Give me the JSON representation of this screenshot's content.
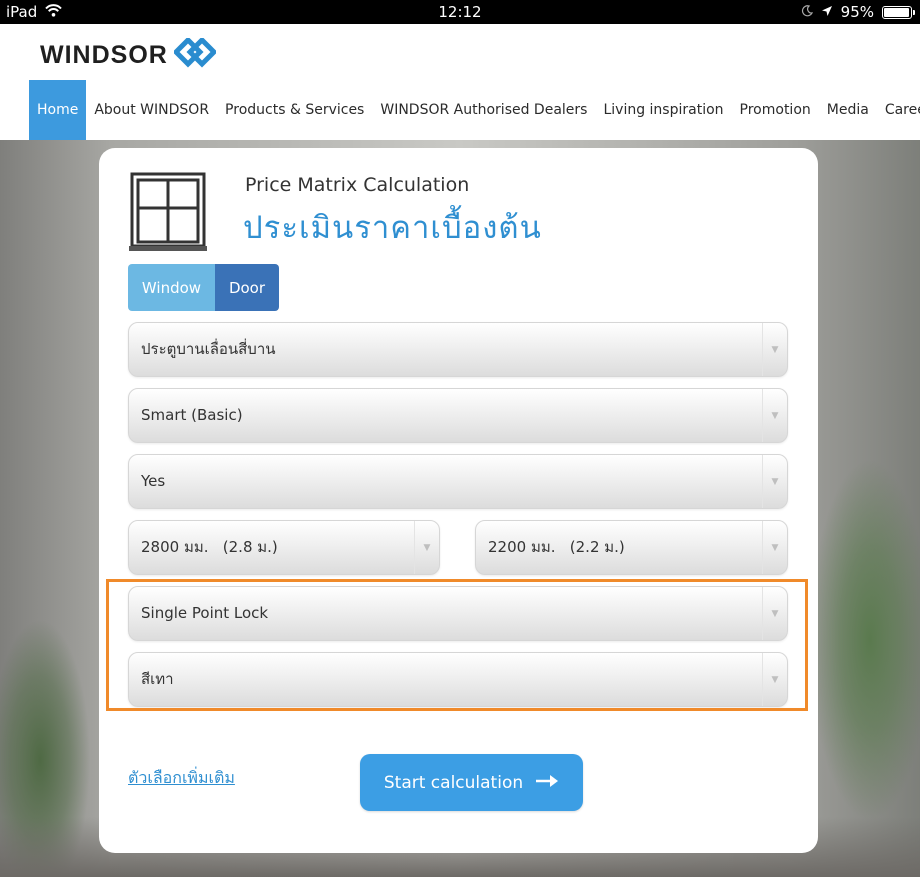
{
  "status_bar": {
    "device": "iPad",
    "time": "12:12",
    "battery": "95%",
    "battery_level": 0.95
  },
  "brand": {
    "name": "WINDSOR",
    "accent": "#3d9ade"
  },
  "nav": {
    "items": [
      {
        "label": "Home",
        "active": true
      },
      {
        "label": "About WINDSOR"
      },
      {
        "label": "Products & Services"
      },
      {
        "label": "WINDSOR Authorised Dealers"
      },
      {
        "label": "Living inspiration"
      },
      {
        "label": "Promotion"
      },
      {
        "label": "Media"
      },
      {
        "label": "Careers"
      }
    ]
  },
  "calculator": {
    "title_en": "Price Matrix Calculation",
    "title_th": "ประเมินราคาเบื้องต้น",
    "tabs": {
      "window": "Window",
      "door": "Door"
    },
    "selects": {
      "type": "ประตูบานเลื่อนสี่บาน",
      "series": "Smart (Basic)",
      "option": "Yes",
      "width": "2800 มม.   (2.8 ม.)",
      "height": "2200 มม.   (2.2 ม.)",
      "lock": "Single Point Lock",
      "color": "สีเทา"
    },
    "more_link": "ตัวเลือกเพิ่มเติม",
    "start_label": "Start calculation"
  }
}
